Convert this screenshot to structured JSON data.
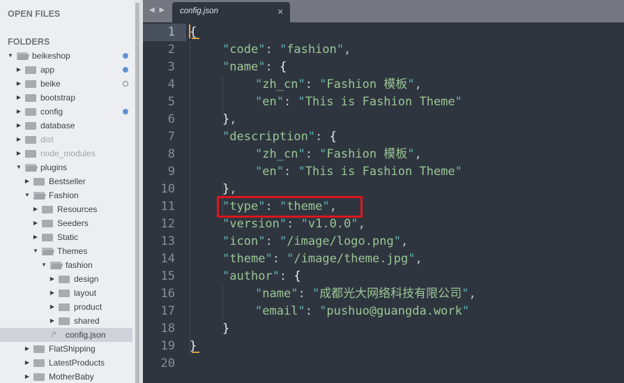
{
  "sidebar": {
    "open_files_title": "OPEN FILES",
    "folders_title": "FOLDERS",
    "tree": [
      {
        "label": "beikeshop",
        "depth": 0,
        "type": "folder",
        "expanded": true,
        "status": "filled"
      },
      {
        "label": "app",
        "depth": 1,
        "type": "folder",
        "expanded": false,
        "status": "filled"
      },
      {
        "label": "beike",
        "depth": 1,
        "type": "folder",
        "expanded": false,
        "status": "hollow"
      },
      {
        "label": "bootstrap",
        "depth": 1,
        "type": "folder",
        "expanded": false,
        "status": ""
      },
      {
        "label": "config",
        "depth": 1,
        "type": "folder",
        "expanded": false,
        "status": "filled"
      },
      {
        "label": "database",
        "depth": 1,
        "type": "folder",
        "expanded": false,
        "status": ""
      },
      {
        "label": "dist",
        "depth": 1,
        "type": "folder",
        "expanded": false,
        "status": "",
        "dim": true
      },
      {
        "label": "node_modules",
        "depth": 1,
        "type": "folder",
        "expanded": false,
        "status": "",
        "dim": true
      },
      {
        "label": "plugins",
        "depth": 1,
        "type": "folder",
        "expanded": true,
        "status": ""
      },
      {
        "label": "Bestseller",
        "depth": 2,
        "type": "folder",
        "expanded": false,
        "status": ""
      },
      {
        "label": "Fashion",
        "depth": 2,
        "type": "folder",
        "expanded": true,
        "status": ""
      },
      {
        "label": "Resources",
        "depth": 3,
        "type": "folder",
        "expanded": false,
        "status": ""
      },
      {
        "label": "Seeders",
        "depth": 3,
        "type": "folder",
        "expanded": false,
        "status": ""
      },
      {
        "label": "Static",
        "depth": 3,
        "type": "folder",
        "expanded": false,
        "status": ""
      },
      {
        "label": "Themes",
        "depth": 3,
        "type": "folder",
        "expanded": true,
        "status": ""
      },
      {
        "label": "fashion",
        "depth": 4,
        "type": "folder",
        "expanded": true,
        "status": ""
      },
      {
        "label": "design",
        "depth": 5,
        "type": "folder",
        "expanded": false,
        "status": ""
      },
      {
        "label": "layout",
        "depth": 5,
        "type": "folder",
        "expanded": false,
        "status": ""
      },
      {
        "label": "product",
        "depth": 5,
        "type": "folder",
        "expanded": false,
        "status": ""
      },
      {
        "label": "shared",
        "depth": 5,
        "type": "folder",
        "expanded": false,
        "status": ""
      },
      {
        "label": "config.json",
        "depth": 3,
        "type": "file",
        "icon": "/*",
        "selected": true,
        "status": ""
      },
      {
        "label": "FlatShipping",
        "depth": 2,
        "type": "folder",
        "expanded": false,
        "status": ""
      },
      {
        "label": "LatestProducts",
        "depth": 2,
        "type": "folder",
        "expanded": false,
        "status": ""
      },
      {
        "label": "MotherBaby",
        "depth": 2,
        "type": "folder",
        "expanded": false,
        "status": ""
      }
    ]
  },
  "tabbar": {
    "nav_arrows": "◀ ▶",
    "active_tab": "config.json",
    "close_glyph": "×"
  },
  "editor": {
    "active_line": 1,
    "highlighted_line": 11,
    "lines": [
      {
        "n": "1",
        "indent": 0,
        "tokens": [
          [
            "b",
            "{"
          ]
        ]
      },
      {
        "n": "2",
        "indent": 1,
        "tokens": [
          [
            "q",
            "\""
          ],
          [
            "s",
            "code"
          ],
          [
            "q",
            "\""
          ],
          [
            "p",
            ": "
          ],
          [
            "q",
            "\""
          ],
          [
            "s",
            "fashion"
          ],
          [
            "q",
            "\""
          ],
          [
            "p",
            ","
          ]
        ]
      },
      {
        "n": "3",
        "indent": 1,
        "tokens": [
          [
            "q",
            "\""
          ],
          [
            "s",
            "name"
          ],
          [
            "q",
            "\""
          ],
          [
            "p",
            ": "
          ],
          [
            "b",
            "{"
          ]
        ]
      },
      {
        "n": "4",
        "indent": 2,
        "tokens": [
          [
            "q",
            "\""
          ],
          [
            "s",
            "zh_cn"
          ],
          [
            "q",
            "\""
          ],
          [
            "p",
            ": "
          ],
          [
            "q",
            "\""
          ],
          [
            "s",
            "Fashion 模板"
          ],
          [
            "q",
            "\""
          ],
          [
            "p",
            ","
          ]
        ]
      },
      {
        "n": "5",
        "indent": 2,
        "tokens": [
          [
            "q",
            "\""
          ],
          [
            "s",
            "en"
          ],
          [
            "q",
            "\""
          ],
          [
            "p",
            ": "
          ],
          [
            "q",
            "\""
          ],
          [
            "s",
            "This is Fashion Theme"
          ],
          [
            "q",
            "\""
          ]
        ]
      },
      {
        "n": "6",
        "indent": 1,
        "tokens": [
          [
            "b",
            "}"
          ],
          [
            "p",
            ","
          ]
        ]
      },
      {
        "n": "7",
        "indent": 1,
        "tokens": [
          [
            "q",
            "\""
          ],
          [
            "s",
            "description"
          ],
          [
            "q",
            "\""
          ],
          [
            "p",
            ": "
          ],
          [
            "b",
            "{"
          ]
        ]
      },
      {
        "n": "8",
        "indent": 2,
        "tokens": [
          [
            "q",
            "\""
          ],
          [
            "s",
            "zh_cn"
          ],
          [
            "q",
            "\""
          ],
          [
            "p",
            ": "
          ],
          [
            "q",
            "\""
          ],
          [
            "s",
            "Fashion 模板"
          ],
          [
            "q",
            "\""
          ],
          [
            "p",
            ","
          ]
        ]
      },
      {
        "n": "9",
        "indent": 2,
        "tokens": [
          [
            "q",
            "\""
          ],
          [
            "s",
            "en"
          ],
          [
            "q",
            "\""
          ],
          [
            "p",
            ": "
          ],
          [
            "q",
            "\""
          ],
          [
            "s",
            "This is Fashion Theme"
          ],
          [
            "q",
            "\""
          ]
        ]
      },
      {
        "n": "10",
        "indent": 1,
        "tokens": [
          [
            "b",
            "}"
          ],
          [
            "p",
            ","
          ]
        ]
      },
      {
        "n": "11",
        "indent": 1,
        "tokens": [
          [
            "q",
            "\""
          ],
          [
            "s",
            "type"
          ],
          [
            "q",
            "\""
          ],
          [
            "p",
            ": "
          ],
          [
            "q",
            "\""
          ],
          [
            "s",
            "theme"
          ],
          [
            "q",
            "\""
          ],
          [
            "p",
            ","
          ]
        ]
      },
      {
        "n": "12",
        "indent": 1,
        "tokens": [
          [
            "q",
            "\""
          ],
          [
            "s",
            "version"
          ],
          [
            "q",
            "\""
          ],
          [
            "p",
            ": "
          ],
          [
            "q",
            "\""
          ],
          [
            "s",
            "v1.0.0"
          ],
          [
            "q",
            "\""
          ],
          [
            "p",
            ","
          ]
        ]
      },
      {
        "n": "13",
        "indent": 1,
        "tokens": [
          [
            "q",
            "\""
          ],
          [
            "s",
            "icon"
          ],
          [
            "q",
            "\""
          ],
          [
            "p",
            ": "
          ],
          [
            "q",
            "\""
          ],
          [
            "s",
            "/image/logo.png"
          ],
          [
            "q",
            "\""
          ],
          [
            "p",
            ","
          ]
        ]
      },
      {
        "n": "14",
        "indent": 1,
        "tokens": [
          [
            "q",
            "\""
          ],
          [
            "s",
            "theme"
          ],
          [
            "q",
            "\""
          ],
          [
            "p",
            ": "
          ],
          [
            "q",
            "\""
          ],
          [
            "s",
            "/image/theme.jpg"
          ],
          [
            "q",
            "\""
          ],
          [
            "p",
            ","
          ]
        ]
      },
      {
        "n": "15",
        "indent": 1,
        "tokens": [
          [
            "q",
            "\""
          ],
          [
            "s",
            "author"
          ],
          [
            "q",
            "\""
          ],
          [
            "p",
            ": "
          ],
          [
            "b",
            "{"
          ]
        ]
      },
      {
        "n": "16",
        "indent": 2,
        "tokens": [
          [
            "q",
            "\""
          ],
          [
            "s",
            "name"
          ],
          [
            "q",
            "\""
          ],
          [
            "p",
            ": "
          ],
          [
            "q",
            "\""
          ],
          [
            "s",
            "成都光大网络科技有限公司"
          ],
          [
            "q",
            "\""
          ],
          [
            "p",
            ","
          ]
        ]
      },
      {
        "n": "17",
        "indent": 2,
        "tokens": [
          [
            "q",
            "\""
          ],
          [
            "s",
            "email"
          ],
          [
            "q",
            "\""
          ],
          [
            "p",
            ": "
          ],
          [
            "q",
            "\""
          ],
          [
            "s",
            "pushuo@guangda.work"
          ],
          [
            "q",
            "\""
          ]
        ]
      },
      {
        "n": "18",
        "indent": 1,
        "tokens": [
          [
            "b",
            "}"
          ]
        ]
      },
      {
        "n": "19",
        "indent": 0,
        "tokens": [
          [
            "b",
            "}"
          ]
        ]
      },
      {
        "n": "20",
        "indent": 0,
        "tokens": []
      }
    ]
  },
  "colors": {
    "highlight_box": "#e0141b",
    "status_dot": "#5e93d1",
    "string": "#99c794",
    "quote": "#5fb3b3"
  }
}
